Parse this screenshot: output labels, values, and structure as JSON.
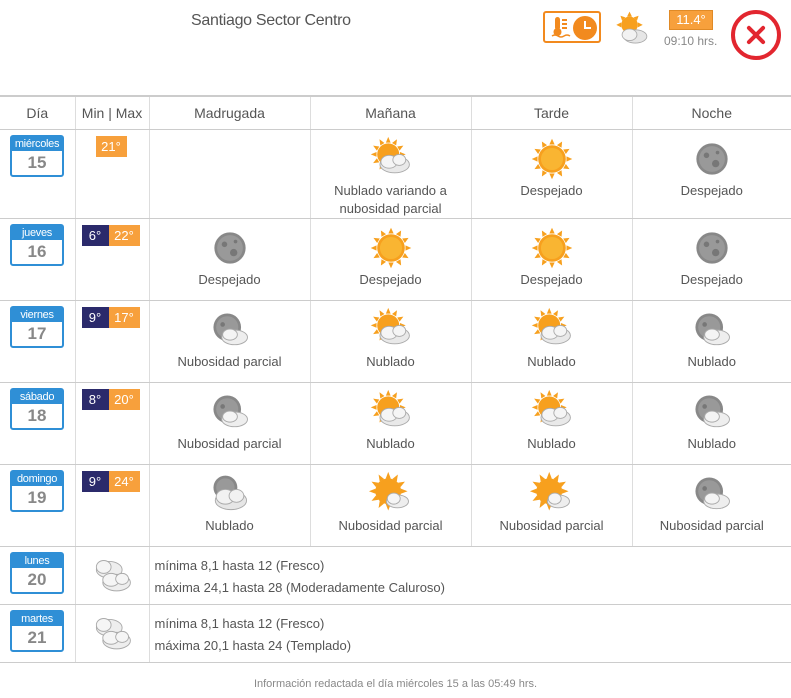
{
  "header": {
    "station": "Santiago Sector Centro",
    "current_temp": "11.4°",
    "current_time": "09:10 hrs.",
    "current_icon": "partly-cloudy-icon"
  },
  "columns": [
    "Día",
    "Min | Max",
    "Madrugada",
    "Mañana",
    "Tarde",
    "Noche"
  ],
  "days": [
    {
      "name": "miércoles",
      "num": "15",
      "min": "",
      "max": "21°",
      "madrugada": {
        "icon": "",
        "label": ""
      },
      "manana": {
        "icon": "cloudy-sun",
        "label": "Nublado variando a nubosidad parcial"
      },
      "tarde": {
        "icon": "sun",
        "label": "Despejado"
      },
      "noche": {
        "icon": "moon",
        "label": "Despejado"
      }
    },
    {
      "name": "jueves",
      "num": "16",
      "min": "6°",
      "max": "22°",
      "madrugada": {
        "icon": "moon",
        "label": "Despejado"
      },
      "manana": {
        "icon": "sun",
        "label": "Despejado"
      },
      "tarde": {
        "icon": "sun",
        "label": "Despejado"
      },
      "noche": {
        "icon": "moon",
        "label": "Despejado"
      }
    },
    {
      "name": "viernes",
      "num": "17",
      "min": "9°",
      "max": "17°",
      "madrugada": {
        "icon": "moon-cloud",
        "label": "Nubosidad parcial"
      },
      "manana": {
        "icon": "cloudy-sun",
        "label": "Nublado"
      },
      "tarde": {
        "icon": "cloudy-sun",
        "label": "Nublado"
      },
      "noche": {
        "icon": "moon-cloud",
        "label": "Nublado"
      }
    },
    {
      "name": "sábado",
      "num": "18",
      "min": "8°",
      "max": "20°",
      "madrugada": {
        "icon": "moon-cloud",
        "label": "Nubosidad parcial"
      },
      "manana": {
        "icon": "cloudy-sun",
        "label": "Nublado"
      },
      "tarde": {
        "icon": "cloudy-sun",
        "label": "Nublado"
      },
      "noche": {
        "icon": "moon-cloud",
        "label": "Nublado"
      }
    },
    {
      "name": "domingo",
      "num": "19",
      "min": "9°",
      "max": "24°",
      "madrugada": {
        "icon": "moon-cloudy",
        "label": "Nublado"
      },
      "manana": {
        "icon": "sun-cloud",
        "label": "Nubosidad parcial"
      },
      "tarde": {
        "icon": "sun-cloud",
        "label": "Nubosidad parcial"
      },
      "noche": {
        "icon": "moon-cloud",
        "label": "Nubosidad parcial"
      }
    }
  ],
  "extended": [
    {
      "name": "lunes",
      "num": "20",
      "icon": "clouds",
      "line1": "mínima 8,1 hasta 12 (Fresco)",
      "line2": "máxima 24,1 hasta 28 (Moderadamente Caluroso)"
    },
    {
      "name": "martes",
      "num": "21",
      "icon": "clouds",
      "line1": "mínima 8,1 hasta 12 (Fresco)",
      "line2": "máxima 20,1 hasta 24 (Templado)"
    }
  ],
  "footer": "Información redactada el día miércoles 15 a las 05:49 hrs.",
  "colors": {
    "accent_blue": "#2f8fd6",
    "min_bg": "#2b2a6b",
    "max_bg": "#f7a03c",
    "close_red": "#e2262f"
  }
}
